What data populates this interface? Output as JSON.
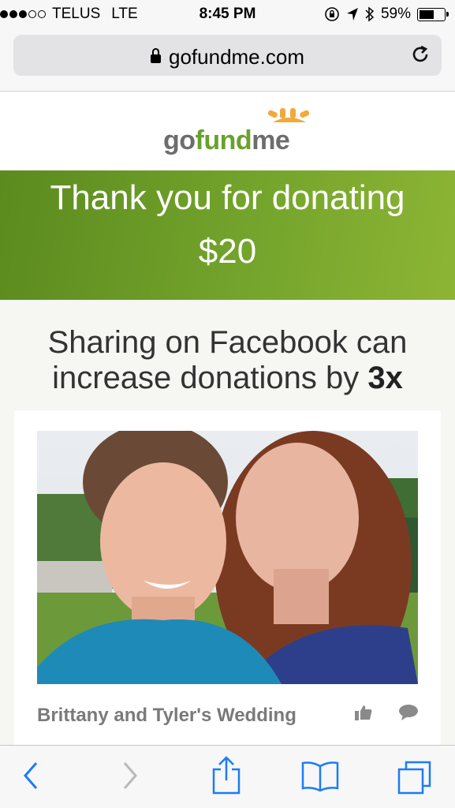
{
  "status_bar": {
    "carrier": "TELUS",
    "network": "LTE",
    "time": "8:45 PM",
    "battery": "59%",
    "battery_level": 0.59
  },
  "browser": {
    "url": "gofundme.com"
  },
  "logo": {
    "go": "go",
    "fund": "fund",
    "me": "me"
  },
  "banner": {
    "thanks": "Thank you for donating",
    "amount": "$20"
  },
  "share": {
    "line1": "Sharing on Facebook can",
    "line2": "increase donations by",
    "multiplier": "3x"
  },
  "campaign": {
    "title": "Brittany and Tyler's Wedding"
  },
  "colors": {
    "brand_green": "#6aa12d",
    "banner_green": "#74a42c",
    "ios_blue": "#1b7cf5"
  }
}
